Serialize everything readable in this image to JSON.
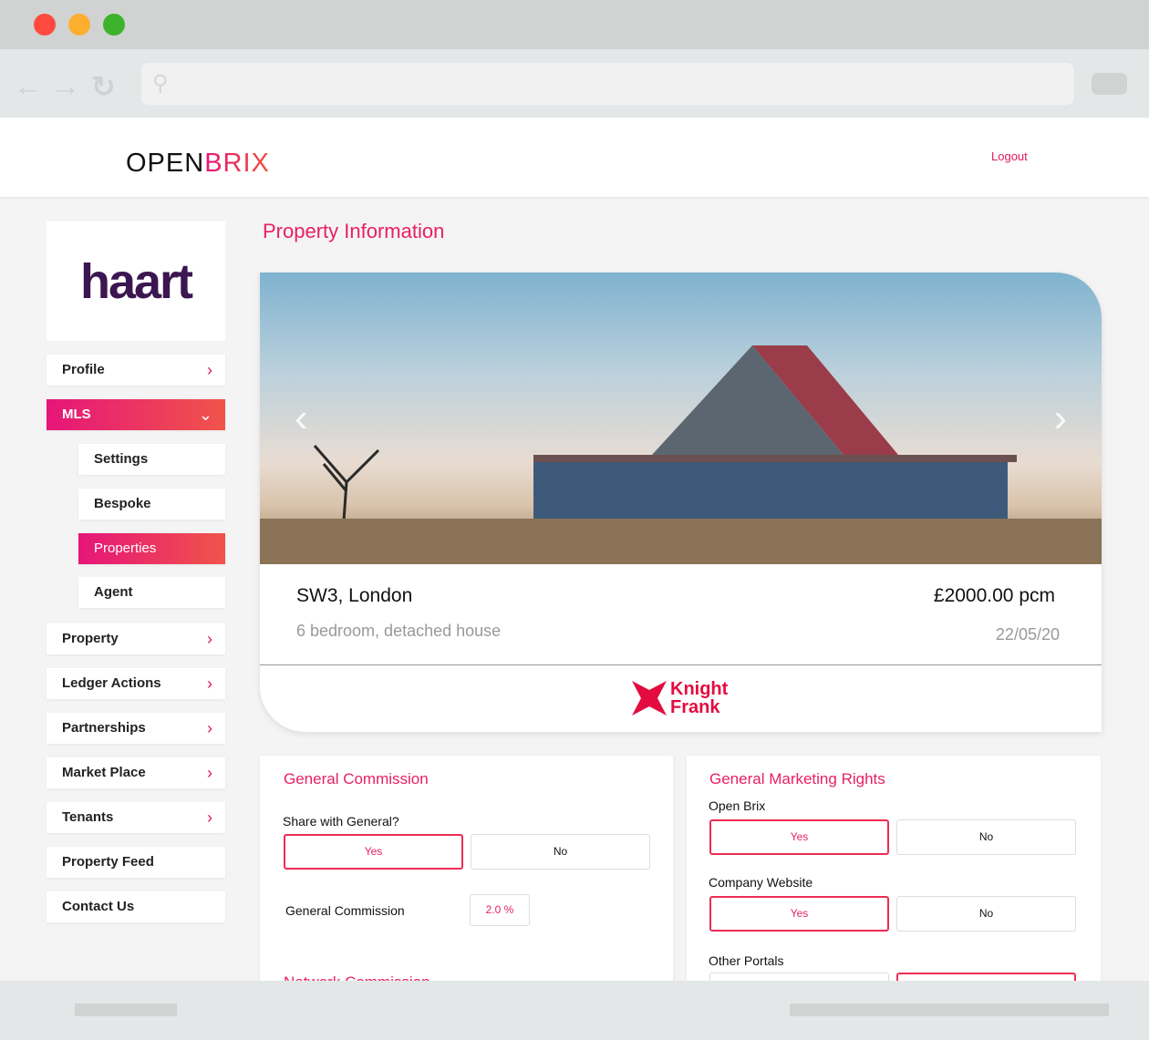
{
  "browser": {
    "window_controls": [
      "close",
      "minimize",
      "maximize"
    ],
    "colors": {
      "close": "#fe4a3f",
      "minimize": "#feae2f",
      "maximize": "#3cb32a"
    }
  },
  "header": {
    "logo_open": "OPEN",
    "logo_brix": "BRIX",
    "logout": "Logout"
  },
  "sidebar": {
    "brand": "haart",
    "items": [
      {
        "label": "Profile",
        "chevron": "right"
      },
      {
        "label": "MLS",
        "chevron": "down",
        "active": true
      },
      {
        "label": "Settings",
        "sub": true
      },
      {
        "label": "Bespoke",
        "sub": true
      },
      {
        "label": "Properties",
        "sub": true,
        "active": true
      },
      {
        "label": "Agent",
        "sub": true
      },
      {
        "label": "Property",
        "chevron": "right"
      },
      {
        "label": "Ledger Actions",
        "chevron": "right"
      },
      {
        "label": "Partnerships",
        "chevron": "right"
      },
      {
        "label": "Market Place",
        "chevron": "right"
      },
      {
        "label": "Tenants",
        "chevron": "right"
      },
      {
        "label": "Property Feed"
      },
      {
        "label": "Contact Us"
      }
    ]
  },
  "main": {
    "title": "Property Information",
    "property": {
      "address": "SW3, London",
      "description": "6 bedroom, detached house",
      "price": "£2000.00 pcm",
      "date": "22/05/20",
      "agent_logo_line1": "Knight",
      "agent_logo_line2": "Frank"
    },
    "general_commission": {
      "title": "General Commission",
      "share_label": "Share with General?",
      "yes": "Yes",
      "no": "No",
      "selected": "Yes",
      "commission_label": "General Commission",
      "commission_value": "2.0 %",
      "next_section": "Network Commission"
    },
    "marketing_rights": {
      "title": "General Marketing Rights",
      "rows": [
        {
          "label": "Open Brix",
          "yes": "Yes",
          "no": "No",
          "selected": "Yes"
        },
        {
          "label": "Company Website",
          "yes": "Yes",
          "no": "No",
          "selected": "Yes"
        },
        {
          "label": "Other Portals",
          "yes": "",
          "no": "",
          "selected": "No"
        }
      ]
    }
  },
  "accent": "#e81f65"
}
